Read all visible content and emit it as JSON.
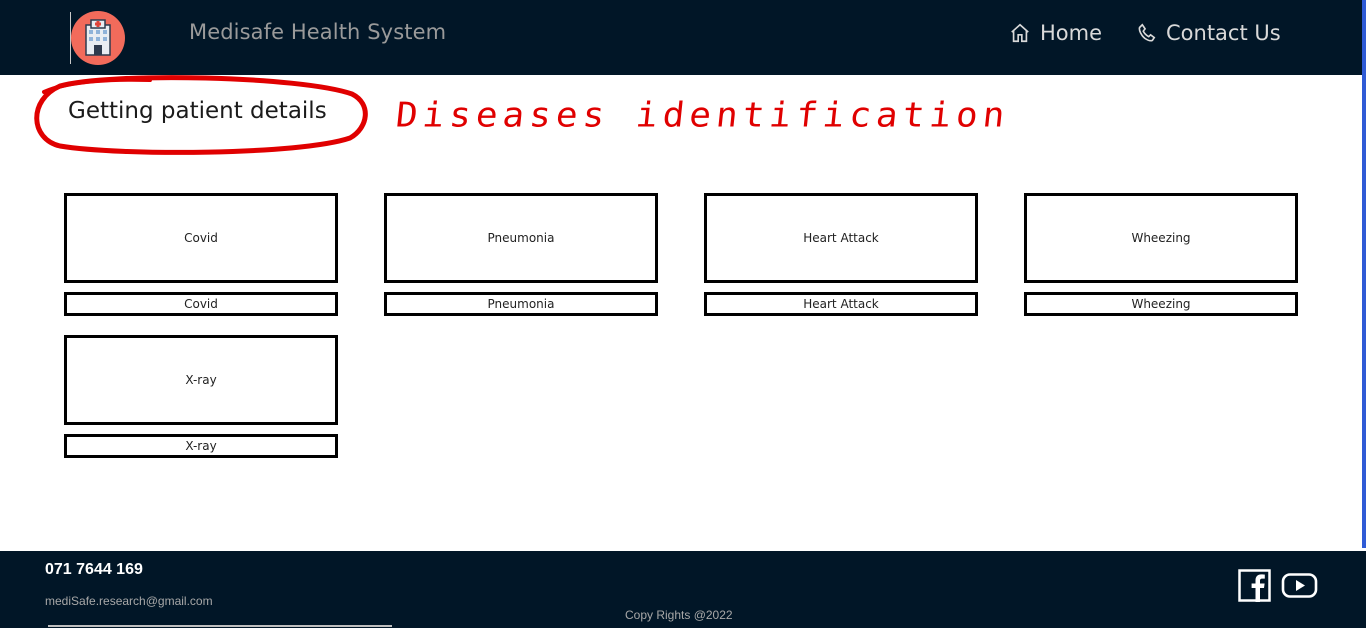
{
  "header": {
    "brand": "Medisafe Health System",
    "nav": [
      {
        "label": "Home",
        "icon": "home-icon"
      },
      {
        "label": "Contact Us",
        "icon": "phone-icon"
      }
    ]
  },
  "main": {
    "title": "Getting patient details",
    "annotation": "Diseases identification",
    "annotation_color": "#e00000",
    "cards": [
      {
        "label": "Covid",
        "button": "Covid"
      },
      {
        "label": "Pneumonia",
        "button": "Pneumonia"
      },
      {
        "label": "Heart Attack",
        "button": "Heart Attack"
      },
      {
        "label": "Wheezing",
        "button": "Wheezing"
      },
      {
        "label": "X-ray",
        "button": "X-ray"
      }
    ]
  },
  "footer": {
    "phone": "071 7644 169",
    "email": "mediSafe.research@gmail.com",
    "copyright": "Copy Rights @2022",
    "social": [
      "facebook-icon",
      "youtube-icon"
    ]
  },
  "colors": {
    "navbar": "#011627",
    "brand_text": "#9a9a9a",
    "accent_edge": "#2f5bd6"
  }
}
